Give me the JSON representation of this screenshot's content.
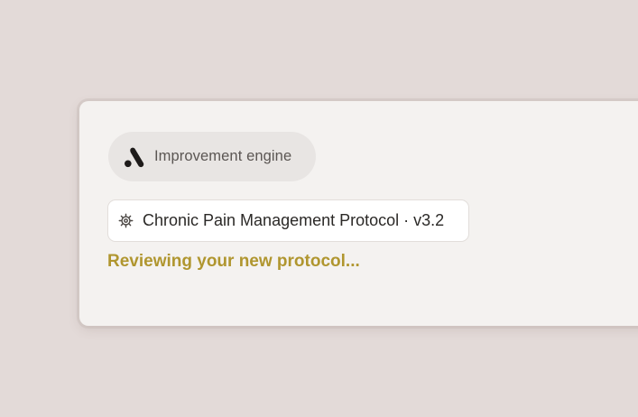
{
  "engine": {
    "label": "Improvement engine",
    "icon": "brand-logo-icon"
  },
  "protocol": {
    "title": "Chronic Pain Management Protocol · v3.2",
    "icon": "gear-icon"
  },
  "status": {
    "text": "Reviewing your new protocol..."
  },
  "colors": {
    "background": "#e3dad8",
    "card": "#f4f2f0",
    "accent_text": "#b0962f"
  }
}
